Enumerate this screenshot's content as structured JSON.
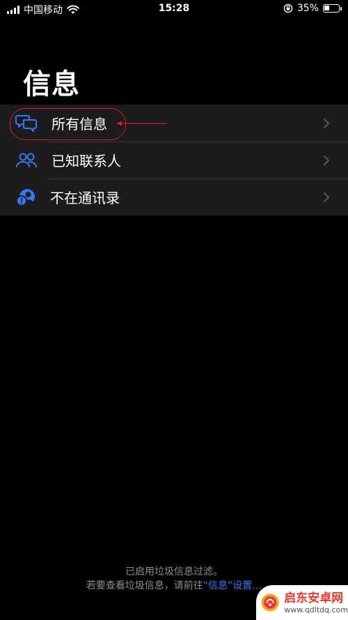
{
  "status_bar": {
    "carrier": "中国移动",
    "time": "15:28",
    "battery_percent": "35%",
    "battery_level": 0.35
  },
  "page": {
    "title": "信息"
  },
  "list": {
    "items": [
      {
        "label": "所有信息",
        "icon": "chat-bubbles-icon"
      },
      {
        "label": "已知联系人",
        "icon": "people-icon"
      },
      {
        "label": "不在通讯录",
        "icon": "unknown-person-icon"
      }
    ]
  },
  "footer": {
    "line1": "已启用垃圾信息过滤。",
    "line2_prefix": "若要查看垃圾信息，请前往",
    "line2_link": "“信息”设置…"
  },
  "watermark": {
    "title": "启东安卓网",
    "url": "www.qdltdq.com"
  },
  "colors": {
    "accent": "#3478f6",
    "annotation": "#d0202a",
    "list_bg": "#1c1c1e"
  }
}
